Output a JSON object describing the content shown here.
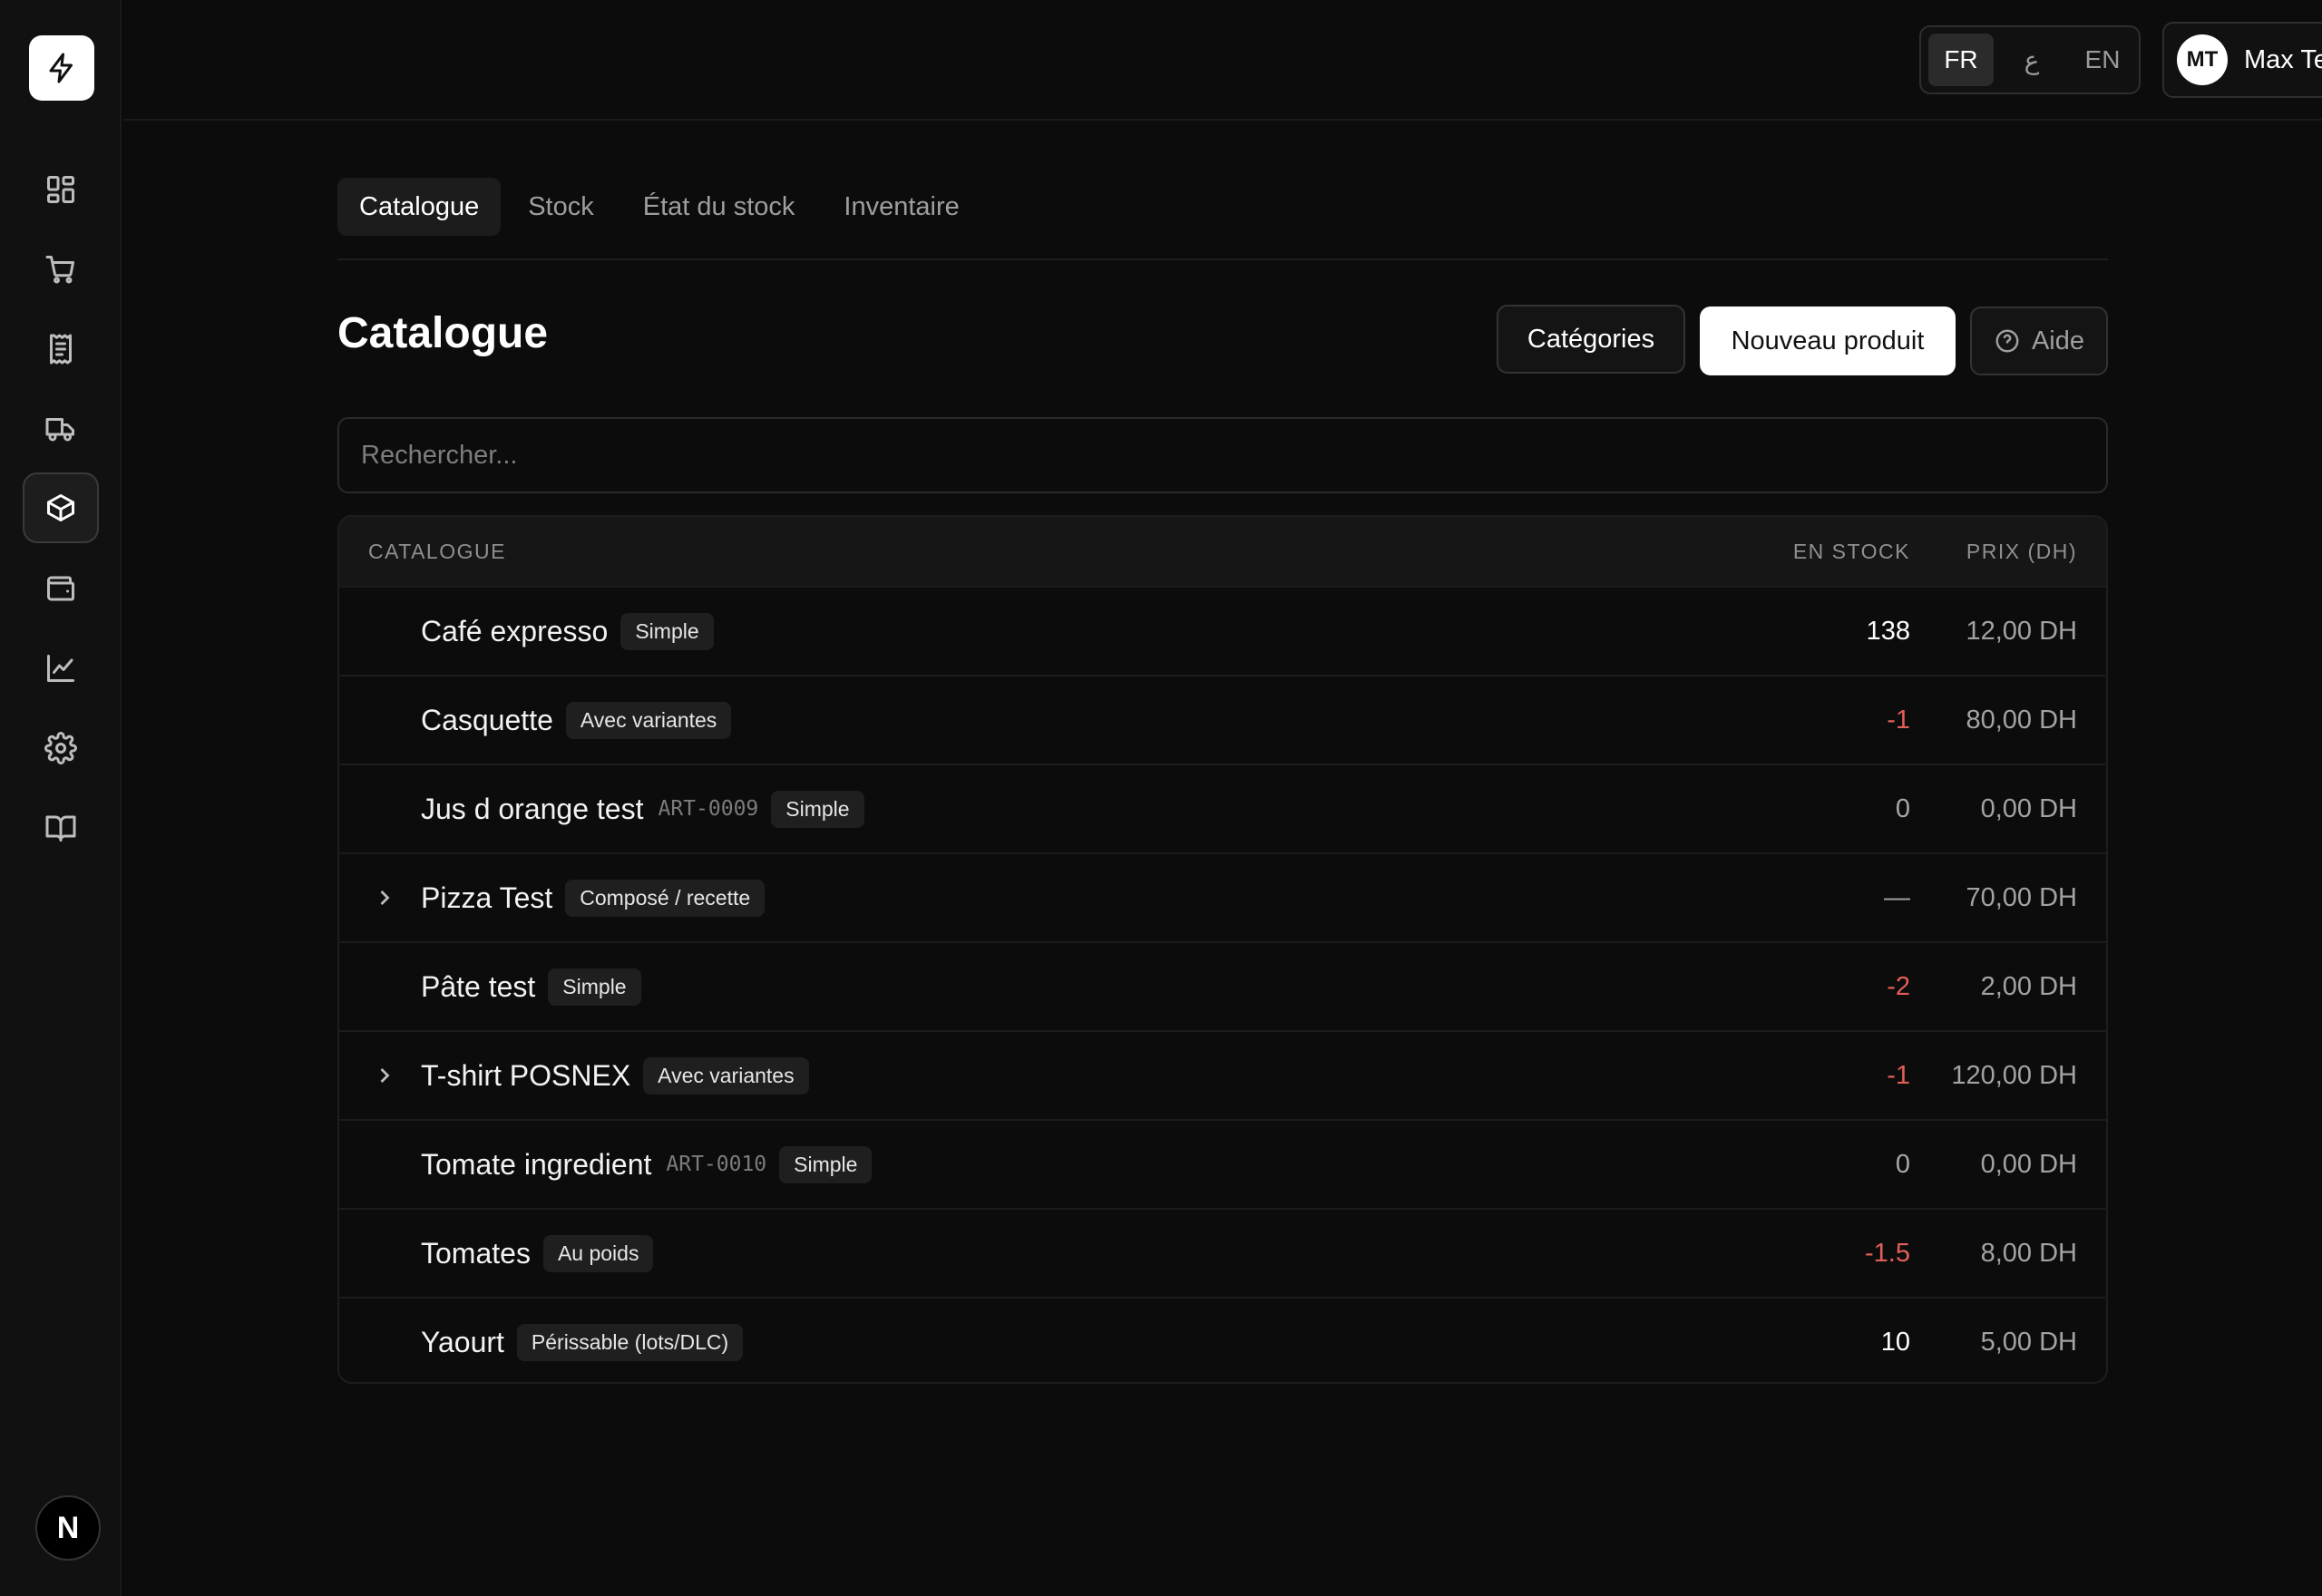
{
  "topbar": {
    "languages": [
      "FR",
      "ع",
      "EN"
    ],
    "active_language": "FR",
    "user": {
      "initials": "MT",
      "name": "Max Test"
    }
  },
  "tabs": [
    {
      "label": "Catalogue",
      "active": true
    },
    {
      "label": "Stock",
      "active": false
    },
    {
      "label": "État du stock",
      "active": false
    },
    {
      "label": "Inventaire",
      "active": false
    }
  ],
  "header": {
    "title": "Catalogue",
    "categories_label": "Catégories",
    "new_product_label": "Nouveau produit",
    "help_label": "Aide"
  },
  "search": {
    "placeholder": "Rechercher..."
  },
  "table": {
    "columns": {
      "name": "CATALOGUE",
      "stock": "EN STOCK",
      "price": "PRIX (DH)"
    },
    "rows": [
      {
        "name": "Café expresso",
        "sku": "",
        "badge": "Simple",
        "stock": "138",
        "price": "12,00 DH",
        "expandable": false
      },
      {
        "name": "Casquette",
        "sku": "",
        "badge": "Avec variantes",
        "stock": "-1",
        "price": "80,00 DH",
        "expandable": false
      },
      {
        "name": "Jus d orange test",
        "sku": "ART-0009",
        "badge": "Simple",
        "stock": "0",
        "price": "0,00 DH",
        "expandable": false
      },
      {
        "name": "Pizza Test",
        "sku": "",
        "badge": "Composé / recette",
        "stock": "—",
        "price": "70,00 DH",
        "expandable": true
      },
      {
        "name": "Pâte test",
        "sku": "",
        "badge": "Simple",
        "stock": "-2",
        "price": "2,00 DH",
        "expandable": false
      },
      {
        "name": "T-shirt POSNEX",
        "sku": "",
        "badge": "Avec variantes",
        "stock": "-1",
        "price": "120,00 DH",
        "expandable": true
      },
      {
        "name": "Tomate ingredient",
        "sku": "ART-0010",
        "badge": "Simple",
        "stock": "0",
        "price": "0,00 DH",
        "expandable": false
      },
      {
        "name": "Tomates",
        "sku": "",
        "badge": "Au poids",
        "stock": "-1.5",
        "price": "8,00 DH",
        "expandable": false
      },
      {
        "name": "Yaourt",
        "sku": "",
        "badge": "Périssable (lots/DLC)",
        "stock": "10",
        "price": "5,00 DH",
        "expandable": false
      }
    ]
  },
  "sidebar": {
    "icons": [
      "dashboard-icon",
      "cart-icon",
      "receipt-icon",
      "truck-icon",
      "package-icon",
      "wallet-icon",
      "chart-icon",
      "settings-icon",
      "book-icon"
    ],
    "active": "package-icon",
    "footer_badge": "N"
  },
  "colors": {
    "negative": "#e25f57",
    "background": "#0c0c0c",
    "accent": "#ffffff"
  }
}
